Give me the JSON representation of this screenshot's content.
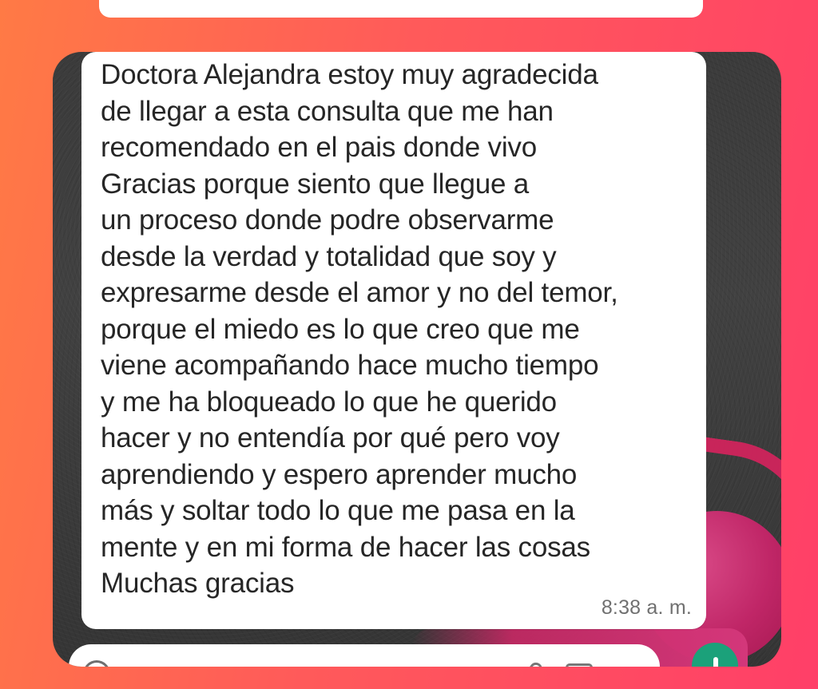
{
  "message": {
    "lines": [
      "Doctora Alejandra estoy muy agradecida",
      "de llegar a esta consulta que me han",
      "recomendado en el pais donde vivo",
      "Gracias porque siento que llegue a",
      "un proceso donde podre observarme",
      "desde la verdad y totalidad que soy y",
      "expresarme desde el amor y no del temor,",
      "porque el miedo es lo que creo que me",
      "viene acompañando hace mucho tiempo",
      "y me ha bloqueado lo que he querido",
      "hacer y no entendía por qué pero voy",
      "aprendiendo y espero aprender mucho",
      "más y soltar todo lo que me pasa en la",
      "mente y en mi forma de hacer las cosas",
      "Muchas gracias"
    ],
    "timestamp": "8:38 a. m."
  },
  "icons": {
    "emoji": "emoji-icon",
    "attach": "paperclip-icon",
    "camera": "camera-icon",
    "mic": "microphone-icon"
  },
  "colors": {
    "background_start": "#ff7a45",
    "background_end": "#ff3f68",
    "bubble": "#ffffff",
    "accent": "#1ba17a"
  }
}
